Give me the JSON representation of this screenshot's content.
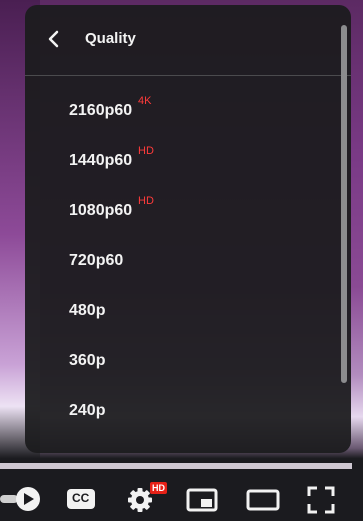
{
  "menu": {
    "title": "Quality",
    "items": [
      {
        "label": "2160p60",
        "badge": "4K"
      },
      {
        "label": "1440p60",
        "badge": "HD"
      },
      {
        "label": "1080p60",
        "badge": "HD"
      },
      {
        "label": "720p60",
        "badge": ""
      },
      {
        "label": "480p",
        "badge": ""
      },
      {
        "label": "360p",
        "badge": ""
      },
      {
        "label": "240p",
        "badge": ""
      }
    ]
  },
  "controls": {
    "cc_label": "CC",
    "settings_badge": "HD"
  },
  "icons": [
    "chevron-left-icon",
    "play-icon",
    "cc-icon",
    "gear-icon",
    "miniplayer-icon",
    "theater-mode-icon",
    "fullscreen-icon"
  ],
  "colors": {
    "badge_red": "#ff3b3b",
    "hd_badge_bg": "#e62117",
    "panel_bg": "#1c1c1e"
  }
}
